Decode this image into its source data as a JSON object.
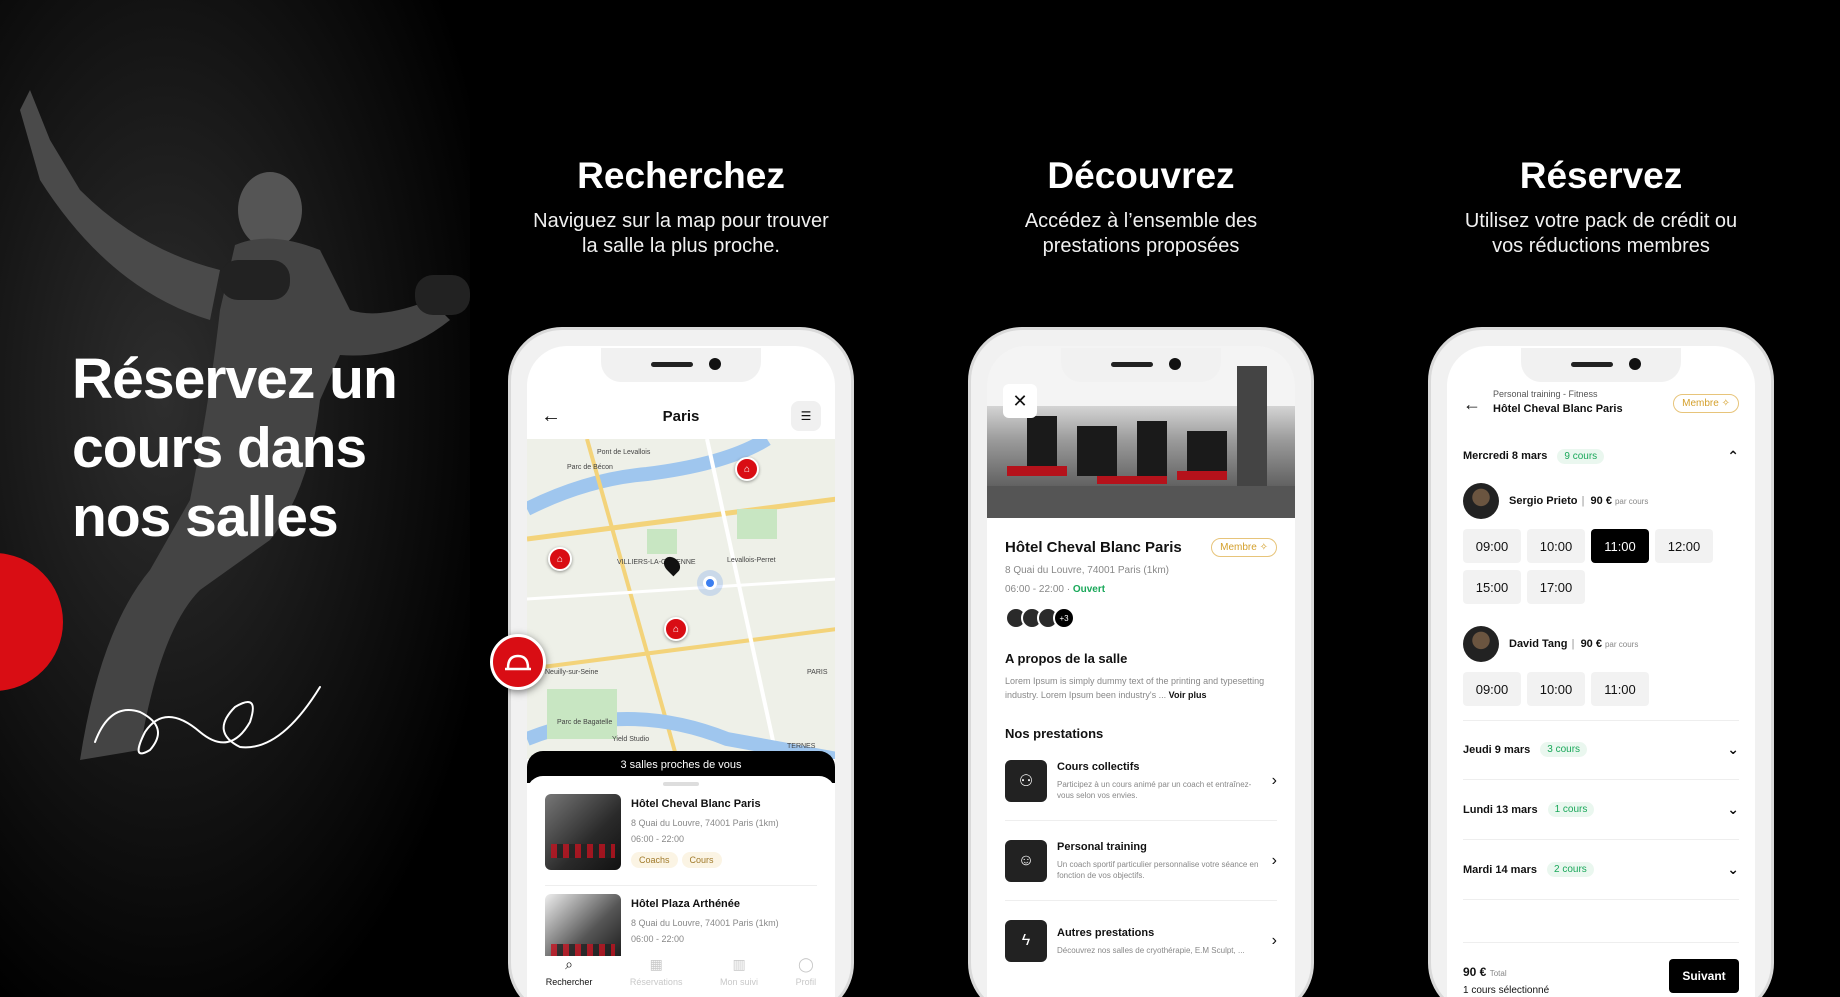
{
  "hero": {
    "title_line1": "Réservez un",
    "title_line2": "cours dans",
    "title_line3": "nos salles"
  },
  "columns": [
    {
      "title": "Recherchez",
      "line1": "Naviguez sur la map pour trouver",
      "line2": "la salle la plus proche."
    },
    {
      "title": "Découvrez",
      "line1": "Accédez à l’ensemble des",
      "line2": "prestations proposées"
    },
    {
      "title": "Réservez",
      "line1": "Utilisez votre pack de crédit ou",
      "line2": "vos réductions membres"
    }
  ],
  "phone1": {
    "city": "Paris",
    "map_labels": [
      "Pont de Levallois",
      "Parc de Bécon",
      "Levallois-Perret",
      "VILLIERS-LA-GARENNE",
      "Neuilly-sur-Seine",
      "Parc de Bagatelle",
      "PARIS",
      "TERNES",
      "Yield Studio"
    ],
    "nearby": "3 salles proches de vous",
    "gyms": [
      {
        "name": "Hôtel Cheval Blanc Paris",
        "address": "8 Quai du Louvre, 74001 Paris (1km)",
        "hours": "06:00 - 22:00",
        "tags": [
          "Coachs",
          "Cours"
        ]
      },
      {
        "name": "Hôtel Plaza Arthénée",
        "address": "8 Quai du Louvre, 74001 Paris (1km)",
        "hours": "06:00 - 22:00",
        "tags": []
      }
    ],
    "tabs": [
      {
        "label": "Rechercher",
        "icon": "search-icon"
      },
      {
        "label": "Réservations",
        "icon": "calendar-icon"
      },
      {
        "label": "Mon suivi",
        "icon": "chart-icon"
      },
      {
        "label": "Profil",
        "icon": "user-icon"
      }
    ]
  },
  "phone2": {
    "name": "Hôtel Cheval Blanc Paris",
    "badge": "Membre",
    "address": "8 Quai du Louvre, 74001 Paris (1km)",
    "hours": "06:00 - 22:00",
    "status": "Ouvert",
    "more_count": "+3",
    "about_title": "A propos de la salle",
    "about_text": "Lorem Ipsum is simply dummy text of the printing and typesetting industry. Lorem Ipsum been industry's ...",
    "about_more": "Voir plus",
    "services_title": "Nos prestations",
    "services": [
      {
        "title": "Cours collectifs",
        "desc": "Participez à un cours animé par un coach et entraînez-vous selon vos envies.",
        "icon": "group-icon"
      },
      {
        "title": "Personal training",
        "desc": "Un coach sportif particulier personnalise votre séance en fonction de vos objectifs.",
        "icon": "person-icon"
      },
      {
        "title": "Autres prestations",
        "desc": "Découvrez nos salles de cryothérapie, E.M Sculpt, ...",
        "icon": "bolt-icon"
      }
    ]
  },
  "phone3": {
    "subtitle": "Personal training - Fitness",
    "title": "Hôtel Cheval Blanc Paris",
    "badge": "Membre",
    "day1": {
      "label": "Mercredi 8 mars",
      "count": "9 cours"
    },
    "coaches": [
      {
        "name": "Sergio Prieto",
        "price": "90 €",
        "per": "par cours",
        "slots": [
          "09:00",
          "10:00",
          "11:00",
          "12:00",
          "15:00",
          "17:00"
        ],
        "selected": "11:00"
      },
      {
        "name": "David Tang",
        "price": "90 €",
        "per": "par cours",
        "slots": [
          "09:00",
          "10:00",
          "11:00"
        ]
      }
    ],
    "days": [
      {
        "label": "Jeudi 9 mars",
        "count": "3 cours"
      },
      {
        "label": "Lundi 13 mars",
        "count": "1 cours"
      },
      {
        "label": "Mardi 14 mars",
        "count": "2 cours"
      }
    ],
    "total": "90 €",
    "total_label": "Total",
    "selected_text": "1 cours sélectionné",
    "next": "Suivant"
  },
  "colors": {
    "brand_red": "#d90d14",
    "member_gold": "#d4a02c",
    "open_green": "#1aa85a"
  }
}
